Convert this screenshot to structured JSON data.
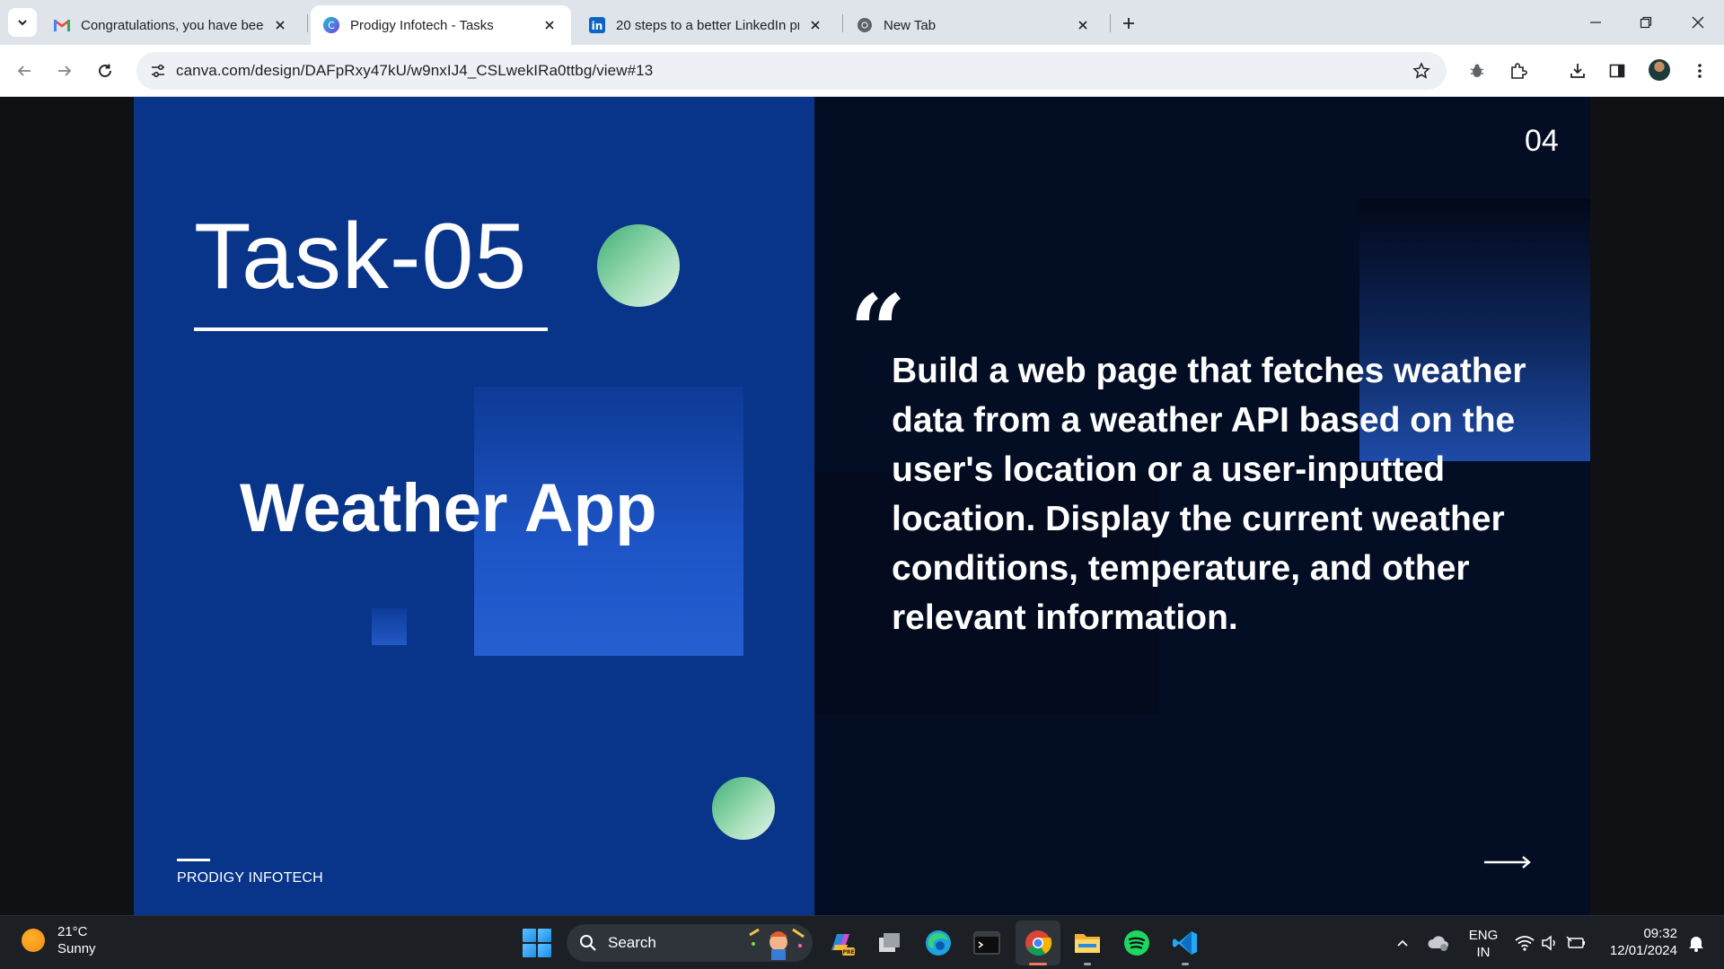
{
  "browser": {
    "tabs": [
      {
        "title": "Congratulations, you have been",
        "icon": "gmail-icon",
        "active": false
      },
      {
        "title": "Prodigy Infotech - Tasks",
        "icon": "canva-icon",
        "active": true
      },
      {
        "title": "20 steps to a better LinkedIn pr",
        "icon": "linkedin-icon",
        "active": false
      },
      {
        "title": "New Tab",
        "icon": "chrome-icon",
        "active": false
      }
    ],
    "url": "canva.com/design/DAFpRxy47kU/w9nxIJ4_CSLwekIRa0ttbg/view#13"
  },
  "slide": {
    "task_label": "Task-05",
    "app_name": "Weather App",
    "brand": "PRODIGY INFOTECH",
    "page_number": "04",
    "quote_mark": "“",
    "description": "Build a web page that fetches weather data from a weather API based on the user's location or a user-inputted location. Display the current weather conditions, temperature, and other relevant information.",
    "colors": {
      "left_panel": "#08348a",
      "right_panel": "#030d24",
      "accent_green": "#9fdcb5"
    }
  },
  "taskbar": {
    "weather": {
      "temp": "21°C",
      "condition": "Sunny"
    },
    "search_placeholder": "Search",
    "tray": {
      "lang_top": "ENG",
      "lang_bottom": "IN"
    },
    "clock": {
      "time": "09:32",
      "date": "12/01/2024"
    }
  }
}
